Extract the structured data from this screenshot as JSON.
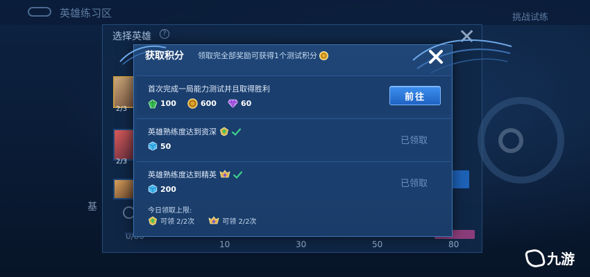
{
  "background": {
    "top_title": "英雄练习区",
    "top_right_label": "挑战试练",
    "panel_title": "选择英雄",
    "help_glyph": "?",
    "hero_fraction_1": "2/3",
    "hero_fraction_2": "2/3",
    "left_label": "基",
    "score_label": "0/80",
    "progress_marks": [
      "10",
      "30",
      "50",
      "80"
    ]
  },
  "dialog": {
    "title": "获取积分",
    "subtitle": "领取完全部奖励可获得1个测试积分",
    "tasks": [
      {
        "title": "首次完成一局能力测试并且取得胜利",
        "rewards": [
          {
            "icon": "green-gem-icon",
            "value": "100"
          },
          {
            "icon": "gold-coin-icon",
            "value": "600"
          },
          {
            "icon": "purple-diamond-icon",
            "value": "60"
          }
        ],
        "action_label": "前往"
      },
      {
        "title": "英雄熟练度达到资深",
        "badge_icon": "green-rank-badge-icon",
        "rewards": [
          {
            "icon": "blue-crystal-icon",
            "value": "50"
          }
        ],
        "status_label": "已领取"
      },
      {
        "title": "英雄熟练度达到精英",
        "badge_icon": "gold-rank-badge-icon",
        "rewards": [
          {
            "icon": "blue-crystal-icon",
            "value": "200"
          }
        ],
        "status_label": "已领取"
      }
    ],
    "daily_limit": {
      "title": "今日领取上限:",
      "items": [
        {
          "icon": "green-rank-badge-icon",
          "label": "可领 2/2次"
        },
        {
          "icon": "gold-rank-badge-icon",
          "label": "可领 2/2次"
        }
      ]
    }
  },
  "watermark": {
    "text": "九游"
  },
  "colors": {
    "dialog_bg": "#1a3c69",
    "button_blue": "#2f7be0",
    "check_green": "#3fd08a",
    "claimed_text": "#6f93bf"
  }
}
